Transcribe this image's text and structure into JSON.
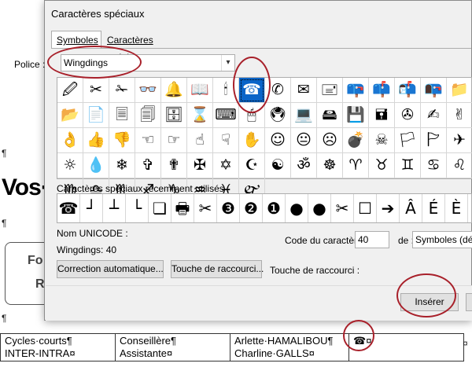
{
  "document": {
    "pilcrow": "¶",
    "title": "Vos·",
    "box_line1": "Fo",
    "box_line2": "R",
    "table": [
      [
        "Cycles·courts¶",
        "Conseillère¶",
        "Arlette·HAMALIBOU¶",
        ""
      ],
      [
        "INTER-INTRA¤",
        "Assistante¤",
        "Charline·GALLS¤",
        ""
      ]
    ],
    "inserted_glyph": "☎",
    "inserted_mark": "¤",
    "end_mark": "¤"
  },
  "dialog": {
    "title": "Caractères spéciaux",
    "tabs": [
      {
        "label": "Symboles",
        "active": true
      },
      {
        "label": "Caractères spéciaux",
        "active": false
      }
    ],
    "font_label": "Police :",
    "font_value": "Wingdings",
    "symbols": [
      "🖉",
      "✂",
      "✁",
      "👓",
      "🔔",
      "📖",
      "🕯",
      "☎",
      "✆",
      "✉",
      "🖃",
      "📪",
      "📫",
      "📬",
      "📭",
      "📁",
      "📂",
      "📄",
      "🗏",
      "🗐",
      "🗄",
      "⌛",
      "⌨",
      "🖱",
      "🖲",
      "💻",
      "🖴",
      "💾",
      "🖬",
      "✇",
      "✍",
      "✌",
      "👌",
      "👍",
      "👎",
      "☜",
      "☞",
      "☝",
      "☟",
      "✋",
      "☺",
      "😐",
      "☹",
      "💣",
      "☠",
      "🏳",
      "🏱",
      "✈",
      "☼",
      "💧",
      "❄",
      "✞",
      "✟",
      "✠",
      "✡",
      "☪",
      "☯",
      "ॐ",
      "☸",
      "♈",
      "♉",
      "♊",
      "♋",
      "♌",
      "♍",
      "♎",
      "♏",
      "♐",
      "♑",
      "♒",
      "♓",
      "🙰"
    ],
    "selected_symbol_index": 7,
    "recent_label": "Caractères spéciaux récemment utilisés :",
    "recent": [
      "☎",
      "┘",
      "┴",
      "└",
      "❏",
      "🖶",
      "✂",
      "❸",
      "❷",
      "❶",
      "●",
      "●",
      "✂",
      "☐",
      "➔",
      "Â",
      "É",
      "È"
    ],
    "unicode_name_label": "Nom UNICODE :",
    "unicode_value": "Wingdings: 40",
    "code_label": "Code du caractère :",
    "code_value": "40",
    "from_label": "de :",
    "from_value": "Symboles (décimal)",
    "autocorrect_button": "Correction automatique...",
    "shortcut_button": "Touche de raccourci...",
    "shortcut_label": "Touche de raccourci :",
    "insert_button": "Insérer"
  },
  "colors": {
    "selection": "#0a64c8",
    "annotation": "#a8202a"
  }
}
